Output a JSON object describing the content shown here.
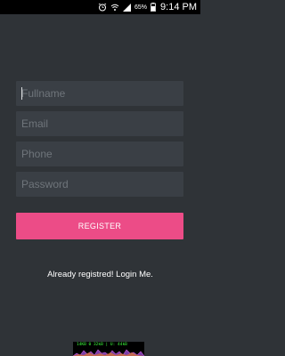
{
  "status_bar": {
    "battery_percent": "65%",
    "time": "9:14 PM",
    "icons": [
      "alarm-icon",
      "wifi-icon",
      "signal-icon",
      "battery-icon"
    ]
  },
  "form": {
    "fullname_placeholder": "Fullname",
    "email_placeholder": "Email",
    "phone_placeholder": "Phone",
    "password_placeholder": "Password"
  },
  "register_button_label": "REGISTER",
  "login_link_label": "Already registred! Login Me.",
  "network_overlay": {
    "text": "14KB 0 32kB | U: 44kB"
  },
  "colors": {
    "background": "#2f3337",
    "field_background": "#3a3f45",
    "accent": "#ec4c87",
    "status_bar": "#000000"
  }
}
